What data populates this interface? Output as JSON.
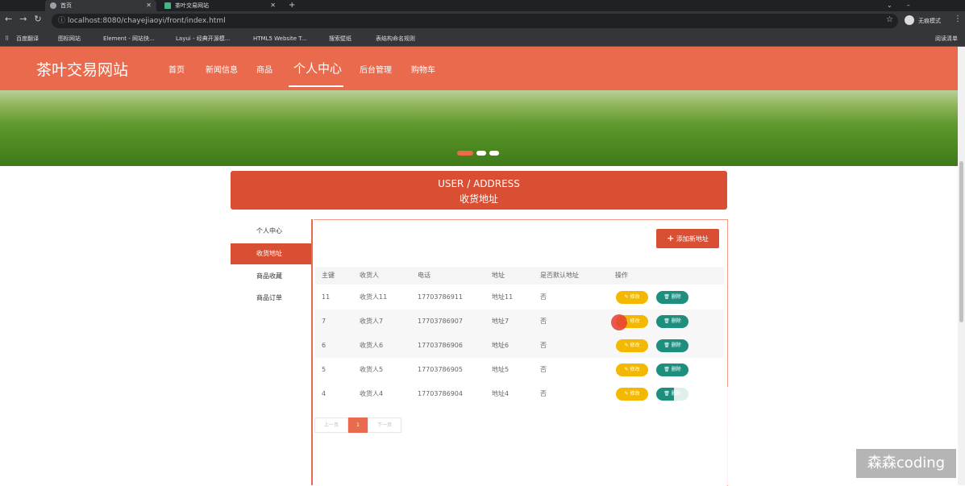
{
  "browser": {
    "tabs": [
      {
        "label": "首页"
      },
      {
        "label": "茶叶交易网站"
      }
    ],
    "url": "localhost:8080/chayejiaoyi/front/index.html",
    "profile_label": "无痕模式",
    "reading_list": "阅读清单",
    "bookmarks": [
      "百度翻译",
      "图标网站",
      "Element - 网站快...",
      "Layui - 经典开源模...",
      "HTML5 Website T...",
      "搜索壁纸",
      "表结构命名规则"
    ]
  },
  "site": {
    "logo": "茶叶交易网站",
    "nav": [
      "首页",
      "新闻信息",
      "商品",
      "个人中心",
      "后台管理",
      "购物车"
    ]
  },
  "title": {
    "en": "USER / ADDRESS",
    "cn": "收货地址"
  },
  "sidebar": {
    "items": [
      "个人中心",
      "收货地址",
      "商品收藏",
      "商品订单"
    ]
  },
  "toolbar": {
    "add_label": "添加新地址"
  },
  "table": {
    "headers": [
      "主键",
      "收货人",
      "电话",
      "地址",
      "是否默认地址",
      "操作"
    ],
    "rows": [
      {
        "id": "11",
        "name": "收货人11",
        "phone": "17703786911",
        "addr": "地址11",
        "default": "否"
      },
      {
        "id": "7",
        "name": "收货人7",
        "phone": "17703786907",
        "addr": "地址7",
        "default": "否"
      },
      {
        "id": "6",
        "name": "收货人6",
        "phone": "17703786906",
        "addr": "地址6",
        "default": "否"
      },
      {
        "id": "5",
        "name": "收货人5",
        "phone": "17703786905",
        "addr": "地址5",
        "default": "否"
      },
      {
        "id": "4",
        "name": "收货人4",
        "phone": "17703786904",
        "addr": "地址4",
        "default": "否"
      }
    ],
    "edit_label": "修改",
    "delete_label": "删除"
  },
  "pagination": {
    "prev": "上一页",
    "current": "1",
    "next": "下一页"
  },
  "watermark": "森森coding",
  "colors": {
    "accent": "#e96a4d",
    "dark_accent": "#d94f34",
    "edit": "#f5b800",
    "delete": "#1e8f7e"
  }
}
